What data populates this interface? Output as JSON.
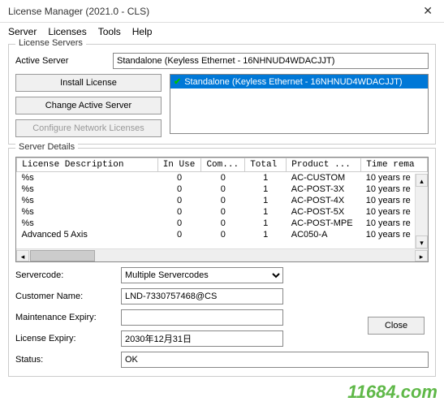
{
  "window": {
    "title": "License Manager (2021.0 - CLS)"
  },
  "menu": {
    "server": "Server",
    "licenses": "Licenses",
    "tools": "Tools",
    "help": "Help"
  },
  "servers": {
    "legend": "License Servers",
    "active_label": "Active Server",
    "active_value": "Standalone (Keyless Ethernet - 16NHNUD4WDACJJT)",
    "btn_install": "Install License",
    "btn_change": "Change Active Server",
    "btn_config": "Configure Network Licenses",
    "list": [
      {
        "label": "Standalone (Keyless Ethernet - 16NHNUD4WDACJJT)",
        "selected": true
      }
    ]
  },
  "details": {
    "legend": "Server Details",
    "columns": {
      "desc": "License Description",
      "inuse": "In Use",
      "com": "Com...",
      "total": "Total",
      "product": "Product ...",
      "time": "Time rema"
    },
    "rows": [
      {
        "desc": "%s",
        "inuse": "0",
        "com": "0",
        "total": "1",
        "product": "AC-CUSTOM",
        "time": "10 years re"
      },
      {
        "desc": "%s",
        "inuse": "0",
        "com": "0",
        "total": "1",
        "product": "AC-POST-3X",
        "time": "10 years re"
      },
      {
        "desc": "%s",
        "inuse": "0",
        "com": "0",
        "total": "1",
        "product": "AC-POST-4X",
        "time": "10 years re"
      },
      {
        "desc": "%s",
        "inuse": "0",
        "com": "0",
        "total": "1",
        "product": "AC-POST-5X",
        "time": "10 years re"
      },
      {
        "desc": "%s",
        "inuse": "0",
        "com": "0",
        "total": "1",
        "product": "AC-POST-MPE",
        "time": "10 years re"
      },
      {
        "desc": "Advanced 5 Axis",
        "inuse": "0",
        "com": "0",
        "total": "1",
        "product": "AC050-A",
        "time": "10 years re"
      }
    ],
    "servercode_label": "Servercode:",
    "servercode_value": "Multiple Servercodes",
    "customer_label": "Customer Name:",
    "customer_value": "LND-7330757468@CS",
    "maint_label": "Maintenance Expiry:",
    "maint_value": "",
    "licexp_label": "License Expiry:",
    "licexp_value": "2030年12月31日",
    "status_label": "Status:",
    "status_value": "OK"
  },
  "close_label": "Close",
  "watermark": "11684.com"
}
